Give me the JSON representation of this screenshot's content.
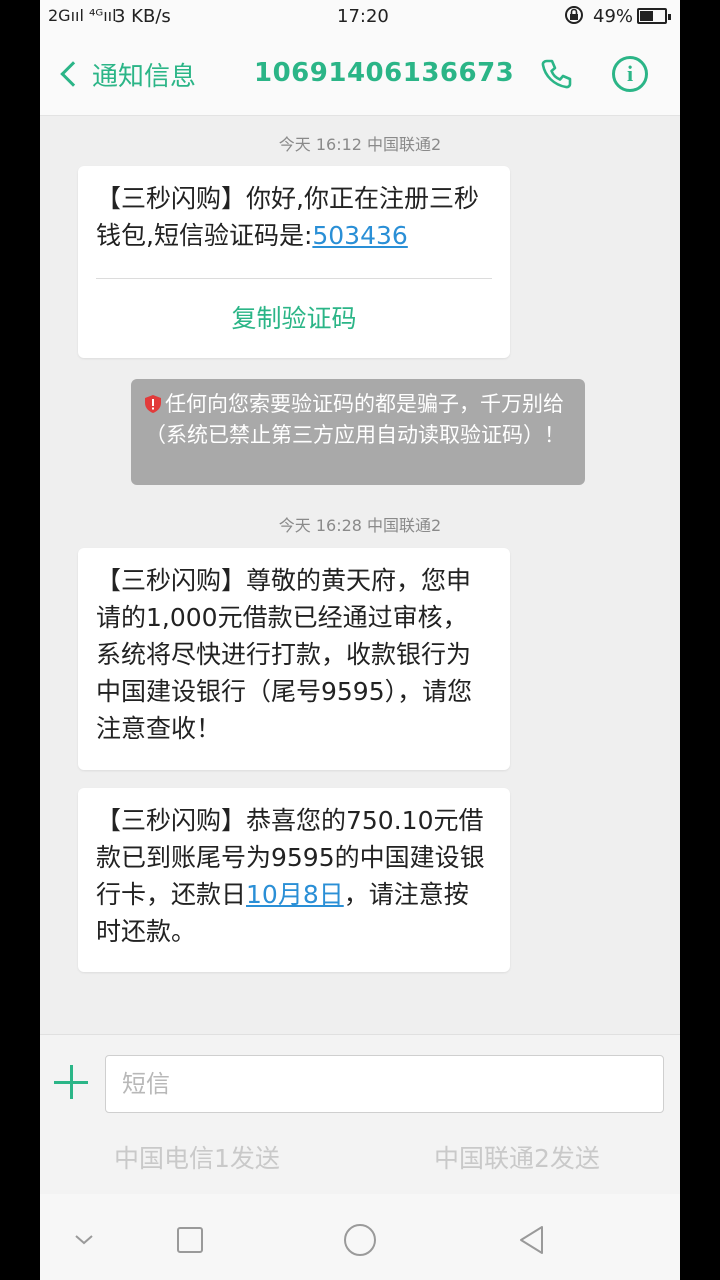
{
  "status_bar": {
    "signal": "2Gııl ⁴ᴳııl",
    "speed": "3 KB/s",
    "time": "17:20",
    "battery": "49%"
  },
  "header": {
    "back_label": "通知信息",
    "title": "10691406136673"
  },
  "messages": [
    {
      "timestamp": "今天 16:12  中国联通2",
      "text_before": "【三秒闪购】你好,你正在注册三秒钱包,短信验证码是:",
      "code": "503436",
      "copy_label": "复制验证码"
    },
    {
      "warning": "任何向您索要验证码的都是骗子，千万别给（系统已禁止第三方应用自动读取验证码）！"
    },
    {
      "timestamp": "今天 16:28  中国联通2",
      "text": "【三秒闪购】尊敬的黄天府，您申请的1,000元借款已经通过审核，系统将尽快进行打款，收款银行为中国建设银行（尾号9595），请您注意查收！"
    },
    {
      "text_before": "【三秒闪购】恭喜您的750.10元借款已到账尾号为9595的中国建设银行卡，还款日",
      "date_link": "10月8日",
      "text_after": "，请注意按时还款。"
    }
  ],
  "composer": {
    "placeholder": "短信",
    "send_sim1": "中国电信1发送",
    "send_sim2": "中国联通2发送"
  },
  "colors": {
    "accent": "#2bb587",
    "link": "#2a8fd6",
    "warning_bg": "#a9a9a9"
  },
  "icons": {
    "back": "chevron-left-icon",
    "call": "phone-icon",
    "info": "info-icon",
    "warning": "shield-icon",
    "add": "plus-icon",
    "nav": [
      "chevron-down-icon",
      "square-icon",
      "circle-icon",
      "triangle-back-icon"
    ]
  }
}
